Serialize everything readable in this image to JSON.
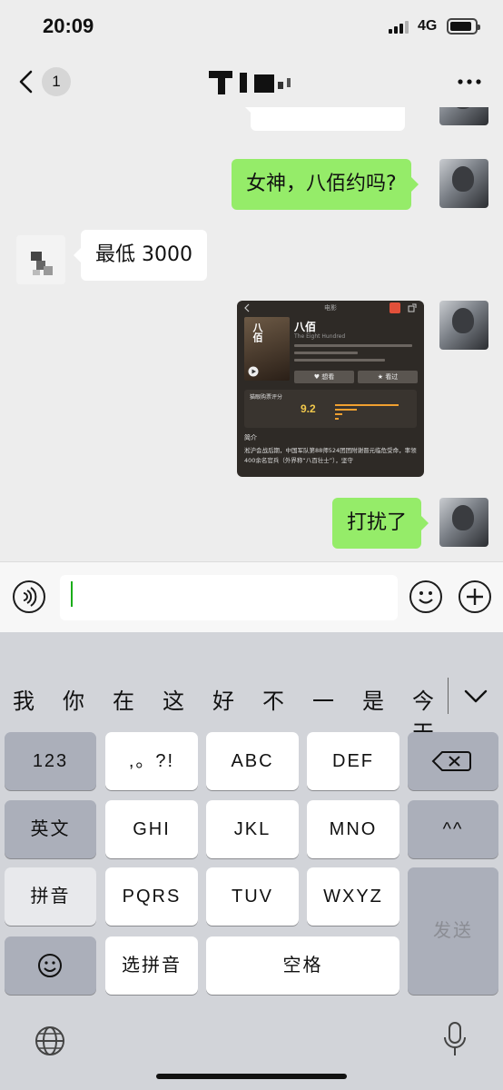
{
  "status_bar": {
    "time": "20:09",
    "network": "4G"
  },
  "header": {
    "unread_count": "1"
  },
  "messages": [
    {
      "from": "me",
      "text": "女神，八佰约吗?"
    },
    {
      "from": "them",
      "text": "最低 3000"
    },
    {
      "from": "me",
      "type": "movie_card",
      "card": {
        "top_label": "电影",
        "poster_title": "八佰",
        "title": "八佰",
        "subtitle": "The Eight Hundred",
        "want_label": "♥ 想看",
        "seen_label": "★ 看过",
        "rating_label": "猫眼购票评分",
        "score": "9.2",
        "intro_label": "简介",
        "intro_text": "淞沪会战后期，中国军队第88师524团团附谢晋元临危受命，率领400余名官兵（外界称“八百壮士”），坚守"
      }
    },
    {
      "from": "me",
      "text": "打扰了"
    }
  ],
  "input": {
    "placeholder": ""
  },
  "keyboard": {
    "candidates": [
      "我",
      "你",
      "在",
      "这",
      "好",
      "不",
      "一",
      "是",
      "今天"
    ],
    "rows": {
      "r1": [
        "123",
        ",。?!",
        "ABC",
        "DEF"
      ],
      "r2": [
        "英文",
        "GHI",
        "JKL",
        "MNO",
        "^^"
      ],
      "r3": [
        "拼音",
        "PQRS",
        "TUV",
        "WXYZ"
      ],
      "send": "发送",
      "r4_select": "选拼音",
      "space": "空格"
    }
  },
  "colors": {
    "bubble_out": "#95ec69",
    "bubble_in": "#ffffff",
    "background": "#ededed"
  }
}
